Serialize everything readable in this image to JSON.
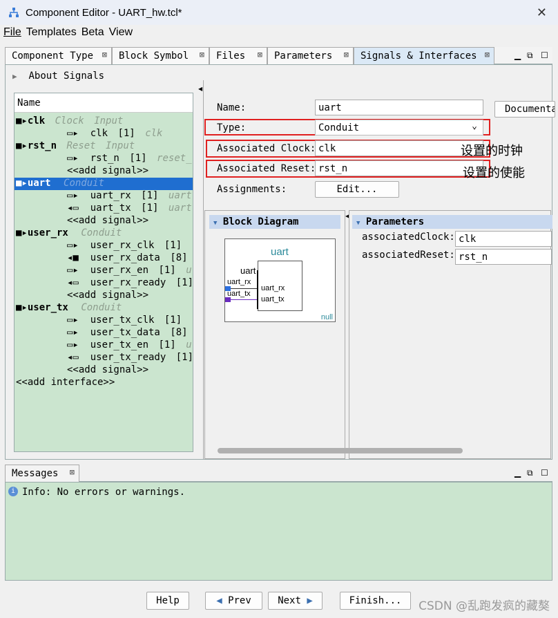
{
  "window": {
    "title": "Component Editor - UART_hw.tcl*",
    "close": "✕"
  },
  "menu": [
    "File",
    "Templates",
    "Beta",
    "View"
  ],
  "tabs": [
    "Component Type",
    "Block Symbol",
    "Files",
    "Parameters",
    "Signals & Interfaces"
  ],
  "tab_close": "⊠",
  "about": "About Signals",
  "list": {
    "header": "Name",
    "rows": [
      {
        "name": "clk",
        "type": "Clock",
        "dir": "Input"
      },
      {
        "name": "clk",
        "width": "[1]",
        "role": "clk"
      },
      {
        "name": "rst_n",
        "type": "Reset",
        "dir": "Input"
      },
      {
        "name": "rst_n",
        "width": "[1]",
        "role": "reset_"
      },
      {
        "add": "<<add signal>>"
      },
      {
        "name": "uart",
        "type": "Conduit"
      },
      {
        "name": "uart_rx",
        "width": "[1]",
        "role": "uart"
      },
      {
        "name": "uart_tx",
        "width": "[1]",
        "role": "uart"
      },
      {
        "add": "<<add signal>>"
      },
      {
        "name": "user_rx",
        "type": "Conduit"
      },
      {
        "name": "user_rx_clk",
        "width": "[1]"
      },
      {
        "name": "user_rx_data",
        "width": "[8]"
      },
      {
        "name": "user_rx_en",
        "width": "[1]",
        "role": "u"
      },
      {
        "name": "user_rx_ready",
        "width": "[1]"
      },
      {
        "add": "<<add signal>>"
      },
      {
        "name": "user_tx",
        "type": "Conduit"
      },
      {
        "name": "user_tx_clk",
        "width": "[1]"
      },
      {
        "name": "user_tx_data",
        "width": "[8]"
      },
      {
        "name": "user_tx_en",
        "width": "[1]",
        "role": "u"
      },
      {
        "name": "user_tx_ready",
        "width": "[1]"
      },
      {
        "add": "<<add signal>>"
      },
      {
        "add": "<<add interface>>"
      }
    ]
  },
  "form": {
    "name_label": "Name:",
    "name_value": "uart",
    "doc_button": "Documenta",
    "type_label": "Type:",
    "type_value": "Conduit",
    "clock_label": "Associated Clock:",
    "clock_value": "clk",
    "reset_label": "Associated Reset:",
    "reset_value": "rst_n",
    "assign_label": "Assignments:",
    "edit_button": "Edit..."
  },
  "annotations": {
    "clock": "设置的时钟",
    "reset": "设置的使能"
  },
  "block_diagram": {
    "title": "Block Diagram",
    "component": "uart",
    "conduit": "uart",
    "ports": [
      "uart_rx",
      "uart_tx"
    ],
    "pins": [
      "uart_rx",
      "uart_tx"
    ],
    "footer": "null"
  },
  "parameters": {
    "title": "Parameters",
    "clock_label": "associatedClock:",
    "clock_value": "clk",
    "reset_label": "associatedReset:",
    "reset_value": "rst_n"
  },
  "messages": {
    "tab": "Messages",
    "text": "Info: No errors or warnings."
  },
  "buttons": {
    "help": "Help",
    "prev": "Prev",
    "next": "Next",
    "finish": "Finish..."
  },
  "watermark": "CSDN @乱跑发疯的藏獒",
  "colors": {
    "list_bg": "#cbe5cf",
    "selection": "#1f6ed0",
    "highlight": "#e02020"
  }
}
